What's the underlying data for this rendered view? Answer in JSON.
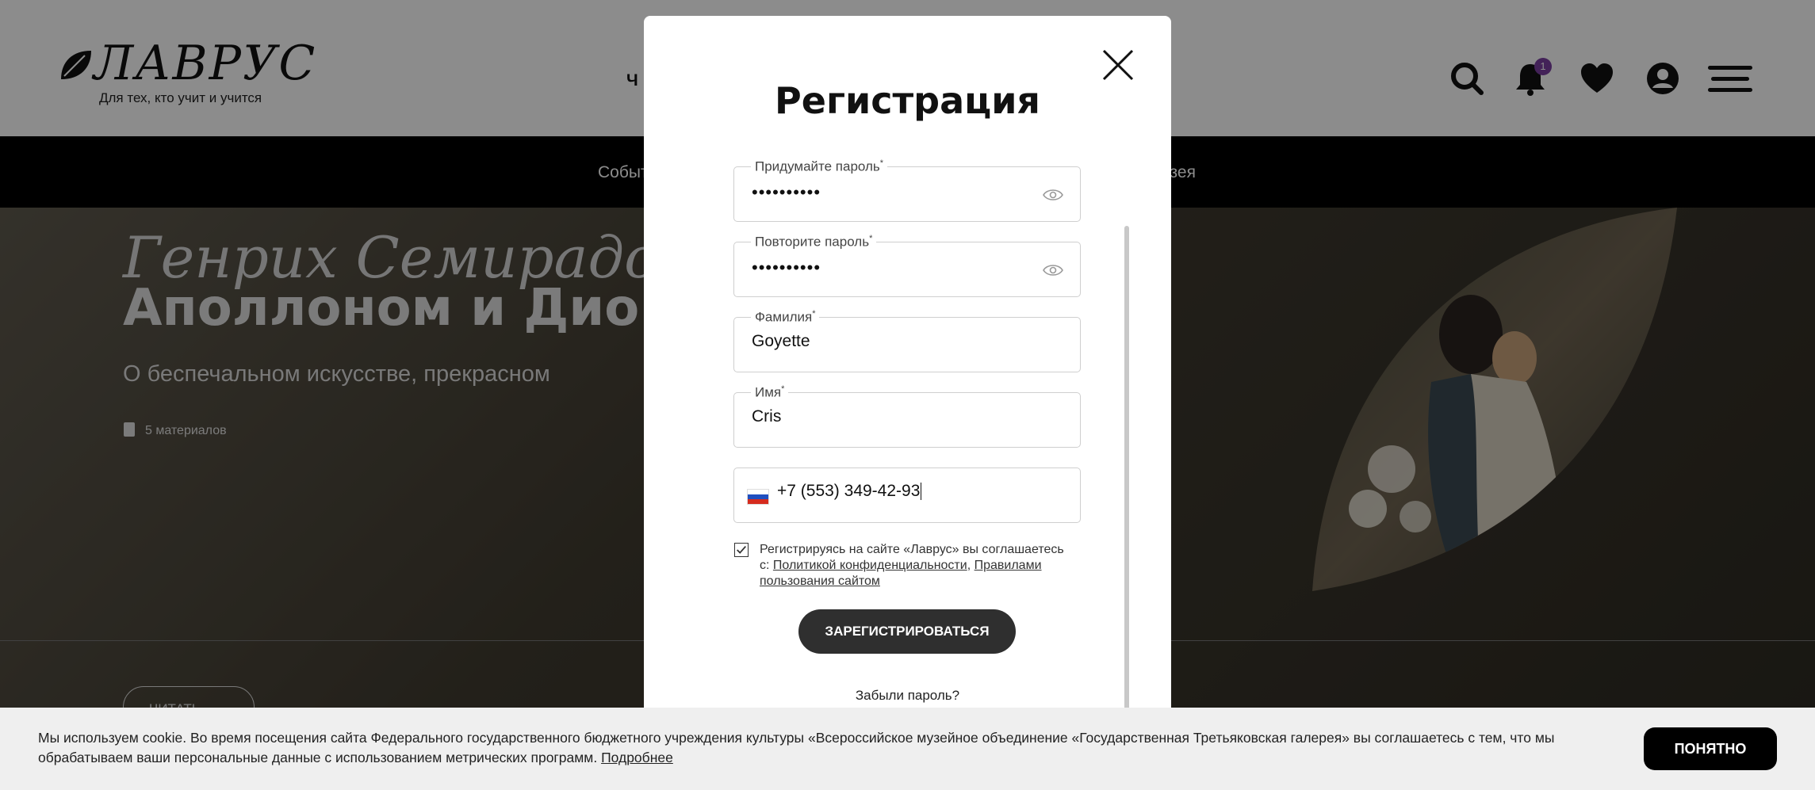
{
  "header": {
    "logo_text": "ЛАВРУС",
    "tagline": "Для тех, кто учит и учится",
    "nav_fragment": "Ч",
    "notification_count": "1",
    "icons": [
      "search-icon",
      "bell-icon",
      "heart-icon",
      "user-icon",
      "menu-icon"
    ]
  },
  "category_bar": {
    "left_fragment": "Событ",
    "right_fragment": "узея"
  },
  "hero": {
    "title_italic": "Генрих Семирадский",
    "title_bold": "Аполлоном и Дио",
    "subtitle": "О беспечальном искусстве, прекрасном",
    "materials_count": "5 материалов",
    "read_button": "ЧИТАТЬ"
  },
  "modal": {
    "title": "Регистрация",
    "fields": {
      "password": {
        "label": "Придумайте пароль",
        "required": "*",
        "value": "••••••••••"
      },
      "password_repeat": {
        "label": "Повторите пароль",
        "required": "*",
        "value": "••••••••••"
      },
      "last_name": {
        "label": "Фамилия",
        "required": "*",
        "value": "Goyette"
      },
      "first_name": {
        "label": "Имя",
        "required": "*",
        "value": "Cris"
      },
      "phone": {
        "value": "+7 (553) 349-42-93"
      }
    },
    "consent": {
      "checked": true,
      "text": "Регистрируясь на сайте «Лаврус» вы соглашаетесь с: ",
      "privacy_link": "Политикой конфиденциальности",
      "separator": ",",
      "terms_link": "Правилами пользования сайтом"
    },
    "register_button": "ЗАРЕГИСТРИРОВАТЬСЯ",
    "forgot_link": "Забыли пароль?"
  },
  "cookie": {
    "text": "Мы используем cookie. Во время посещения сайта Федерального государственного бюджетного учреждения культуры «Всероссийское музейное объединение «Государственная Третьяковская галерея» вы соглашаетесь с тем, что мы обрабатываем ваши персональные данные с использованием метрических программ. ",
    "more_link": "Подробнее",
    "ok_button": "ПОНЯТНО"
  },
  "colors": {
    "accent_badge": "#7a3ea0",
    "button_dark": "#2f2f2f",
    "flag_white": "#ffffff",
    "flag_blue": "#1f4fbf",
    "flag_red": "#d52b1e"
  }
}
